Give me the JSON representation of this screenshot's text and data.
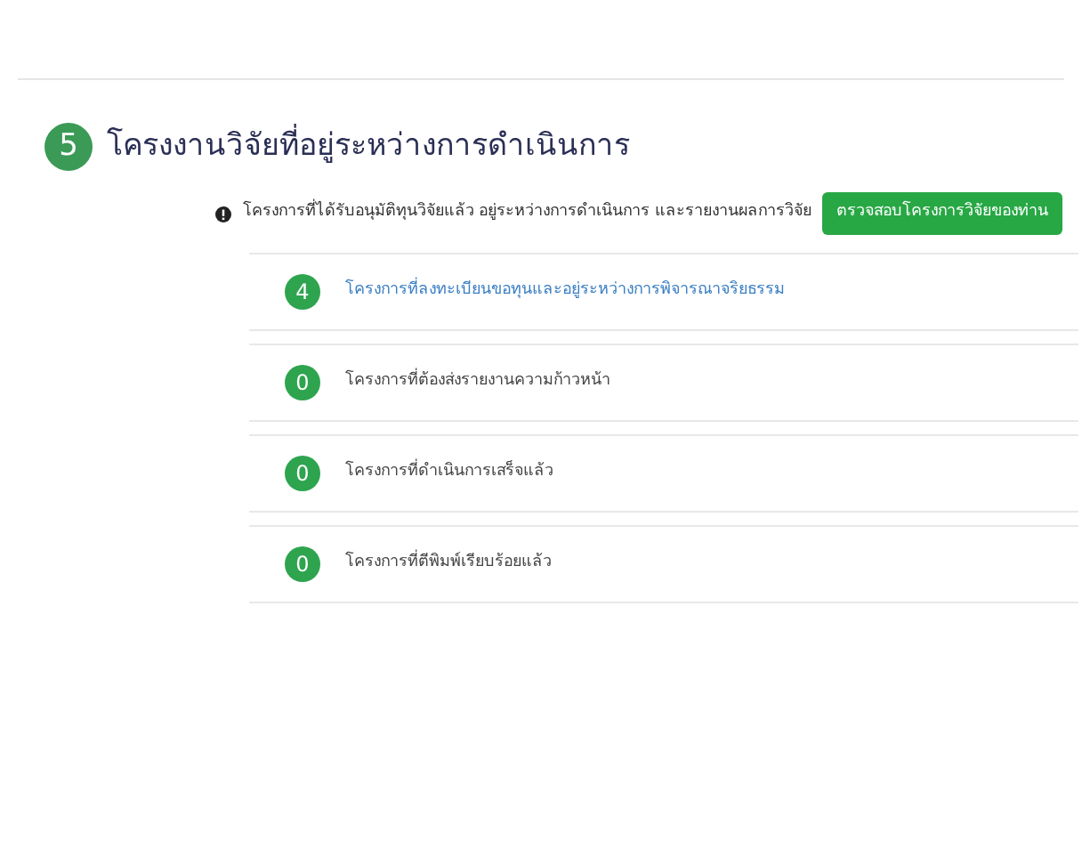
{
  "section": {
    "number": "5",
    "title": "โครงงานวิจัยที่อยู่ระหว่างการดำเนินการ"
  },
  "info": {
    "text": "โครงการที่ได้รับอนุมัติทุนวิจัยแล้ว อยู่ระหว่างการดำเนินการ และรายงานผลการวิจัย",
    "button": "ตรวจสอบโครงการวิจัยของท่าน"
  },
  "items": [
    {
      "count": "4",
      "label": "โครงการที่ลงทะเบียนขอทุนและอยู่ระหว่างการพิจารณาจริยธรรม",
      "linked": true
    },
    {
      "count": "0",
      "label": "โครงการที่ต้องส่งรายงานความก้าวหน้า",
      "linked": false
    },
    {
      "count": "0",
      "label": "โครงการที่ดำเนินการเสร็จแล้ว",
      "linked": false
    },
    {
      "count": "0",
      "label": "โครงการที่ตีพิมพ์เรียบร้อยแล้ว",
      "linked": false
    }
  ]
}
